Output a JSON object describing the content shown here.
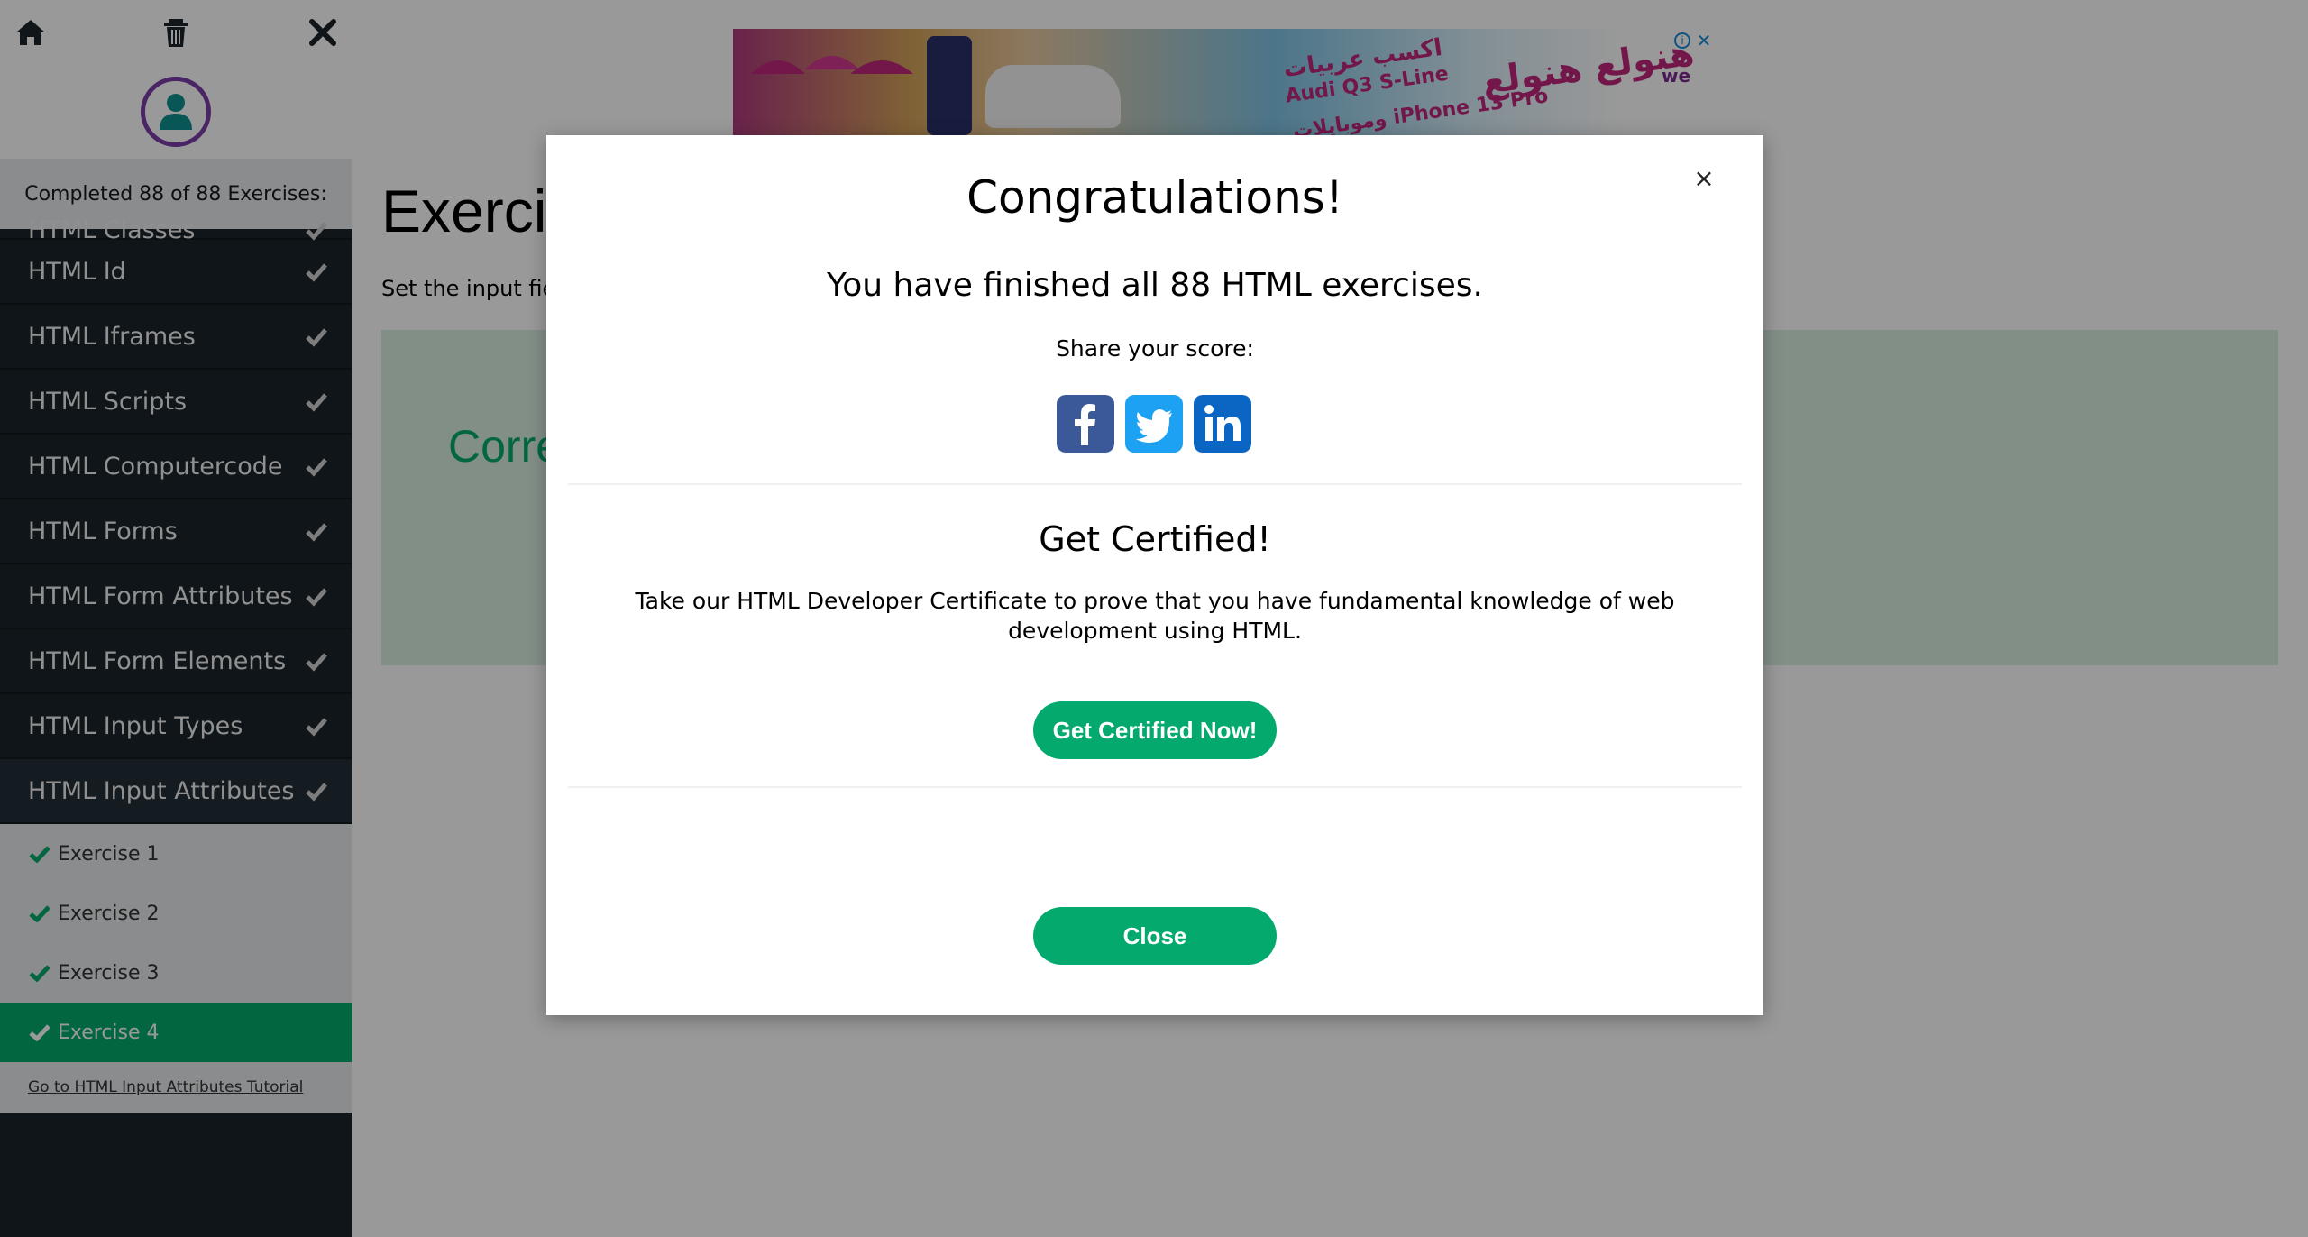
{
  "sidebar": {
    "completed_text": "Completed 88 of 88 Exercises:",
    "topics": [
      {
        "label": "HTML Classes"
      },
      {
        "label": "HTML Id"
      },
      {
        "label": "HTML Iframes"
      },
      {
        "label": "HTML Scripts"
      },
      {
        "label": "HTML Computercode"
      },
      {
        "label": "HTML Forms"
      },
      {
        "label": "HTML Form Attributes"
      },
      {
        "label": "HTML Form Elements"
      },
      {
        "label": "HTML Input Types"
      },
      {
        "label": "HTML Input Attributes"
      }
    ],
    "exercises": [
      {
        "label": "Exercise 1"
      },
      {
        "label": "Exercise 2"
      },
      {
        "label": "Exercise 3"
      },
      {
        "label": "Exercise 4"
      }
    ],
    "tutorial_link": "Go to HTML Input Attributes Tutorial"
  },
  "main": {
    "title": "Exercis",
    "instruction": "Set the input fie",
    "correct": "Corre"
  },
  "ad": {
    "text1": "اكسب عربيات",
    "text2": "Audi Q3 S-Line",
    "text3": "وموبايلات iPhone 13 Pro",
    "big": "هنولع هنولع",
    "brand": "we"
  },
  "modal": {
    "title": "Congratulations!",
    "finished": "You have finished all 88 HTML exercises.",
    "share": "Share your score:",
    "cert_title": "Get Certified!",
    "cert_text": "Take our HTML Developer Certificate to prove that you have fundamental knowledge of web development using HTML.",
    "cert_button": "Get Certified Now!",
    "close_button": "Close",
    "close_icon": "×"
  },
  "colors": {
    "accent": "#04aa6d",
    "sidebar_bg": "#1a2329",
    "avatar_ring": "#7b3fa8"
  }
}
